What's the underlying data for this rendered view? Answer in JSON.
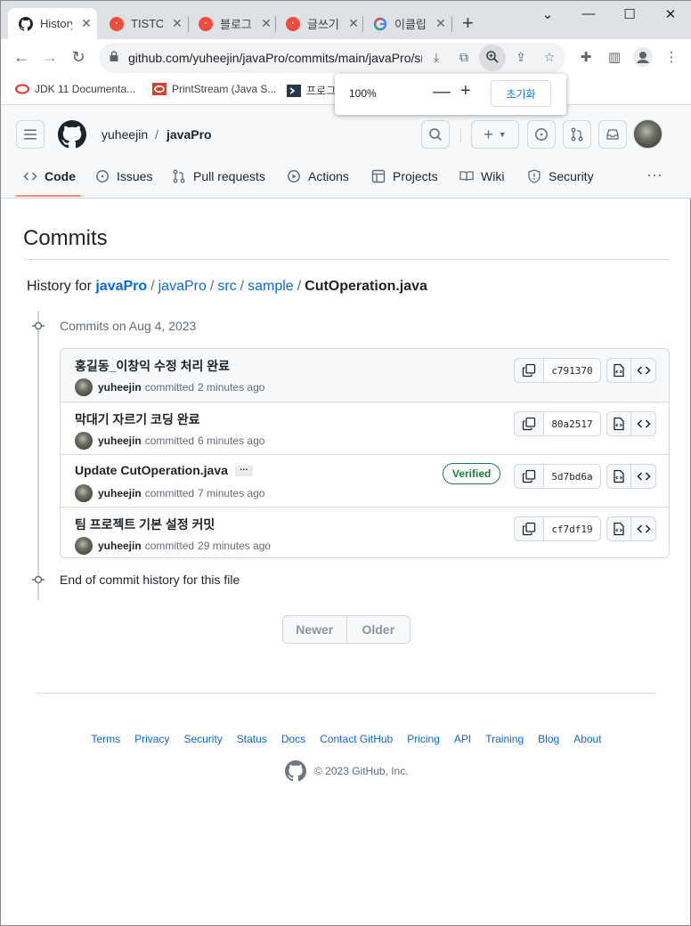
{
  "browser": {
    "tabs": [
      {
        "title": "History",
        "icon": "github-icon"
      },
      {
        "title": "TISTORY",
        "icon": "tistory-icon"
      },
      {
        "title": "블로그",
        "icon": "tistory-icon"
      },
      {
        "title": "글쓰기",
        "icon": "tistory-icon"
      },
      {
        "title": "이클립스",
        "icon": "google-icon"
      }
    ],
    "url": "github.com/yuheejin/javaPro/commits/main/javaPro/src/sample/CutOperation.java",
    "bookmarks": [
      {
        "label": "JDK 11 Documenta..."
      },
      {
        "label": "PrintStream (Java S..."
      },
      {
        "label": "프로그"
      }
    ],
    "zoom": {
      "percent": "100%",
      "reset_label": "초기화"
    }
  },
  "header": {
    "owner": "yuheejin",
    "repo": "javaPro"
  },
  "repo_nav": [
    {
      "label": "Code",
      "icon": "code-icon"
    },
    {
      "label": "Issues",
      "icon": "issue-icon"
    },
    {
      "label": "Pull requests",
      "icon": "pull-request-icon"
    },
    {
      "label": "Actions",
      "icon": "play-icon"
    },
    {
      "label": "Projects",
      "icon": "table-icon"
    },
    {
      "label": "Wiki",
      "icon": "book-icon"
    },
    {
      "label": "Security",
      "icon": "shield-icon"
    }
  ],
  "page": {
    "title": "Commits",
    "history_prefix": "History for",
    "path": [
      "javaPro",
      "javaPro",
      "src",
      "sample"
    ],
    "file": "CutOperation.java",
    "group_heading": "Commits on Aug 4, 2023",
    "end_text": "End of commit history for this file"
  },
  "commits": [
    {
      "message": "홍길동_이창익 수정 처리 완료",
      "author": "yuheejin",
      "verb": "committed",
      "time": "2 minutes ago",
      "sha": "c791370",
      "verified": ""
    },
    {
      "message": "막대기 자르기 코딩 완료",
      "author": "yuheejin",
      "verb": "committed",
      "time": "6 minutes ago",
      "sha": "80a2517",
      "verified": ""
    },
    {
      "message": "Update CutOperation.java",
      "author": "yuheejin",
      "verb": "committed",
      "time": "7 minutes ago",
      "sha": "5d7bd6a",
      "verified": "Verified"
    },
    {
      "message": "팀 프로젝트 기본 설정 커밋",
      "author": "yuheejin",
      "verb": "committed",
      "time": "29 minutes ago",
      "sha": "cf7df19",
      "verified": ""
    }
  ],
  "pager": {
    "newer": "Newer",
    "older": "Older"
  },
  "footer": {
    "links": [
      "Terms",
      "Privacy",
      "Security",
      "Status",
      "Docs",
      "Contact GitHub",
      "Pricing",
      "API",
      "Training",
      "Blog",
      "About"
    ],
    "copyright": "© 2023 GitHub, Inc."
  },
  "colors": {
    "link": "#0969da",
    "verified": "#1a7f37",
    "nav_underline": "#fd8c73",
    "tistory": "#f04b3d"
  }
}
